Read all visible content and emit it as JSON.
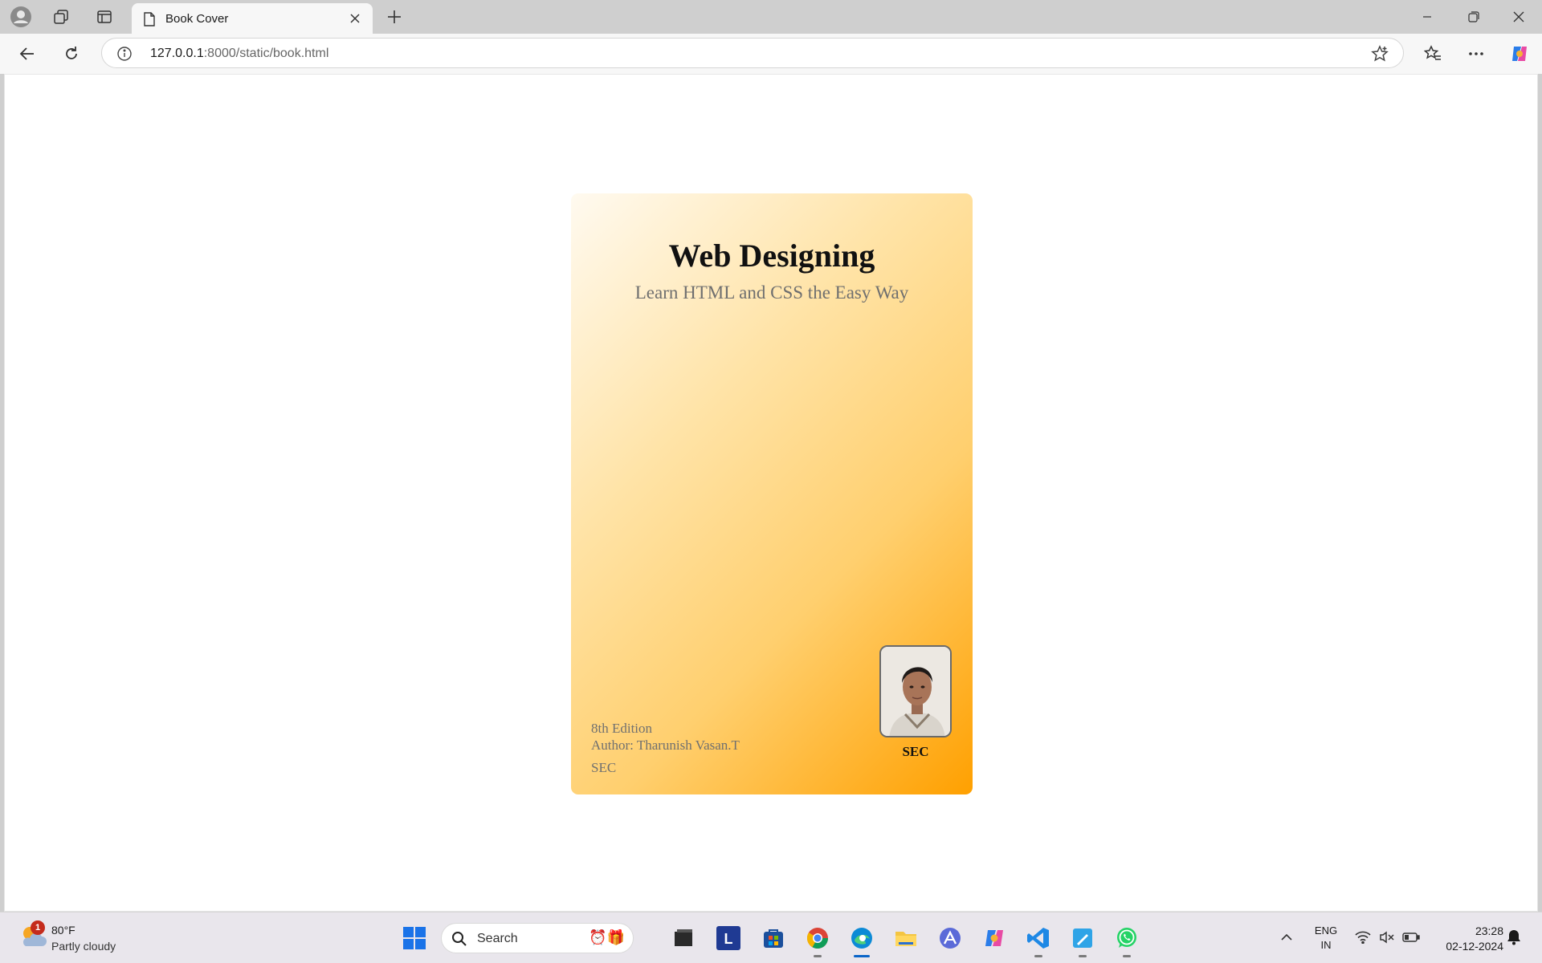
{
  "browser": {
    "tab": {
      "title": "Book Cover"
    },
    "address": {
      "host": "127.0.0.1",
      "path": ":8000/static/book.html"
    }
  },
  "page": {
    "title": "Web Designing",
    "subtitle": "Learn HTML and CSS the Easy Way",
    "edition": "8th Edition",
    "author": "Author: Tharunish Vasan.T",
    "org": "SEC",
    "photo_caption": "SEC",
    "colors": {
      "gradient_start": "#fffaf0",
      "gradient_end": "#ffa000"
    }
  },
  "taskbar": {
    "weather": {
      "temp": "80°F",
      "desc": "Partly cloudy",
      "badge": "1"
    },
    "search_placeholder": "Search",
    "tray": {
      "lang_1": "ENG",
      "lang_2": "IN"
    },
    "clock": {
      "time": "23:28",
      "date": "02-12-2024"
    }
  }
}
